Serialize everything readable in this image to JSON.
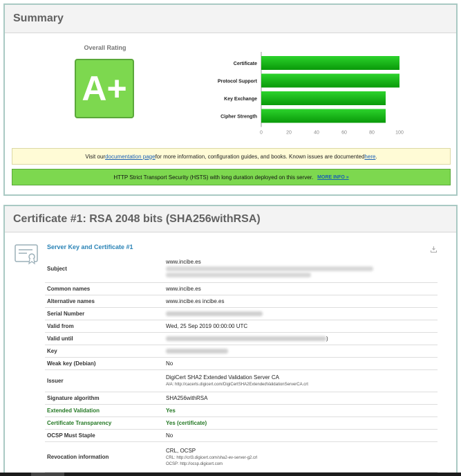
{
  "summary": {
    "title": "Summary",
    "rating_label": "Overall Rating",
    "grade": "A+",
    "notice_yellow": {
      "before": "Visit our ",
      "link1": "documentation page",
      "middle": " for more information, configuration guides, and books. Known issues are documented ",
      "link2": "here",
      "after": "."
    },
    "notice_green": {
      "text": "HTTP Strict Transport Security (HSTS) with long duration deployed on this server.",
      "more": "MORE INFO »"
    },
    "colors": {
      "bar_top": "#2cd32c",
      "bar_bottom": "#099909",
      "grade_bg": "#7dd84f"
    }
  },
  "chart_data": {
    "type": "bar",
    "orientation": "horizontal",
    "categories": [
      "Certificate",
      "Protocol Support",
      "Key Exchange",
      "Cipher Strength"
    ],
    "values": [
      100,
      100,
      90,
      90
    ],
    "xlim": [
      0,
      100
    ],
    "xticks": [
      "0",
      "20",
      "40",
      "60",
      "80",
      "100"
    ]
  },
  "certificate": {
    "title": "Certificate #1: RSA 2048 bits (SHA256withRSA)",
    "section_title": "Server Key and Certificate #1",
    "rows": {
      "subject": {
        "label": "Subject",
        "value": "www.incibe.es"
      },
      "common_names": {
        "label": "Common names",
        "value": "www.incibe.es"
      },
      "alt_names": {
        "label": "Alternative names",
        "value": "www.incibe.es incibe.es"
      },
      "serial": {
        "label": "Serial Number"
      },
      "valid_from": {
        "label": "Valid from",
        "value": "Wed, 25 Sep 2019 00:00:00 UTC"
      },
      "valid_until": {
        "label": "Valid until",
        "value": ")"
      },
      "key": {
        "label": "Key"
      },
      "weak_key": {
        "label": "Weak key (Debian)",
        "value": "No"
      },
      "issuer": {
        "label": "Issuer",
        "value": "DigiCert SHA2 Extended Validation Server CA",
        "sub": "AIA: http://cacerts.digicert.com/DigiCertSHA2ExtendedValidationServerCA.crt"
      },
      "sig_alg": {
        "label": "Signature algorithm",
        "value": "SHA256withRSA"
      },
      "ev": {
        "label": "Extended Validation",
        "value": "Yes"
      },
      "ct": {
        "label": "Certificate Transparency",
        "value": "Yes (certificate)"
      },
      "ocsp_staple": {
        "label": "OCSP Must Staple",
        "value": "No"
      },
      "revocation": {
        "label": "Revocation information",
        "value": "CRL, OCSP",
        "sub1": "CRL: http://crl3.digicert.com/sha2-ev-server-g2.crl",
        "sub2": "OCSP: http://ocsp.digicert.com"
      }
    }
  }
}
